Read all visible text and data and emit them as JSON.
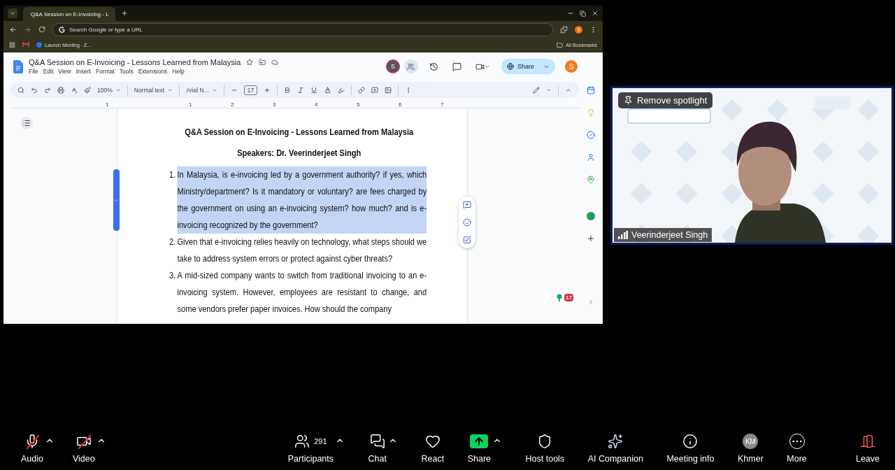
{
  "browser": {
    "tab_title": "Q&A Session on E-Invoicing - L",
    "address_placeholder": "Search Google or type a URL",
    "profile_initial": "S",
    "bookmarks": [
      {
        "label": "Launch Meeting - Z..."
      }
    ],
    "all_bookmarks": "All Bookmarks"
  },
  "doc": {
    "title": "Q&A Session on E-Invoicing - Lessons Learned from Malaysia",
    "menu": [
      "File",
      "Edit",
      "View",
      "Insert",
      "Format",
      "Tools",
      "Extensions",
      "Help"
    ],
    "collaborator_initial": "S",
    "share": "Share",
    "account_initial": "S",
    "toolbar": {
      "zoom": "100%",
      "style": "Normal text",
      "font": "Arial N...",
      "font_size": "17"
    },
    "ruler": [
      "1",
      "1",
      "2",
      "3",
      "4",
      "5",
      "6",
      "7"
    ],
    "heading": "Q&A Session on E-Invoicing - Lessons Learned from Malaysia",
    "subheading": "Speakers: Dr. Veerinderjeet Singh",
    "questions": [
      {
        "number": "1.",
        "text": "In Malaysia, is e-invoicing led by a government authority? if yes, which Ministry/department? Is it mandatory or voluntary? are fees charged by the government on using an e-invoicing system? how much? and is e-invoicing recognized by the government?",
        "selected": true
      },
      {
        "number": "2.",
        "text": "Given that e-invoicing relies heavily on technology, what steps should we take to address system errors or protect against cyber threats?",
        "selected": false
      },
      {
        "number": "3.",
        "text": "A mid-sized company wants to switch from traditional invoicing to an e-invoicing system. However, employees are resistant to change, and some vendors prefer paper invoices. How should the company",
        "selected": false
      }
    ],
    "addon_badge": "17"
  },
  "meeting": {
    "spotlight_button": "Remove spotlight",
    "participant_name": "Veerinderjeet Singh",
    "toolbar": [
      {
        "kind": "audio",
        "label": "Audio",
        "off": true,
        "menu": true
      },
      {
        "kind": "video",
        "label": "Video",
        "off": true,
        "menu": true
      },
      {
        "kind": "participants",
        "label": "Participants",
        "count": "291",
        "menu": true
      },
      {
        "kind": "chat",
        "label": "Chat",
        "menu": true
      },
      {
        "kind": "react",
        "label": "React",
        "menu": false
      },
      {
        "kind": "share",
        "label": "Share",
        "menu": true
      },
      {
        "kind": "host",
        "label": "Host tools",
        "menu": false
      },
      {
        "kind": "ai",
        "label": "AI Companion",
        "menu": false
      },
      {
        "kind": "info",
        "label": "Meeting info",
        "menu": false
      },
      {
        "kind": "avatar",
        "label": "Khmer",
        "avatar": "KM",
        "menu": false
      },
      {
        "kind": "more",
        "label": "More",
        "menu": false
      },
      {
        "kind": "leave",
        "label": "Leave",
        "menu": false
      }
    ]
  }
}
